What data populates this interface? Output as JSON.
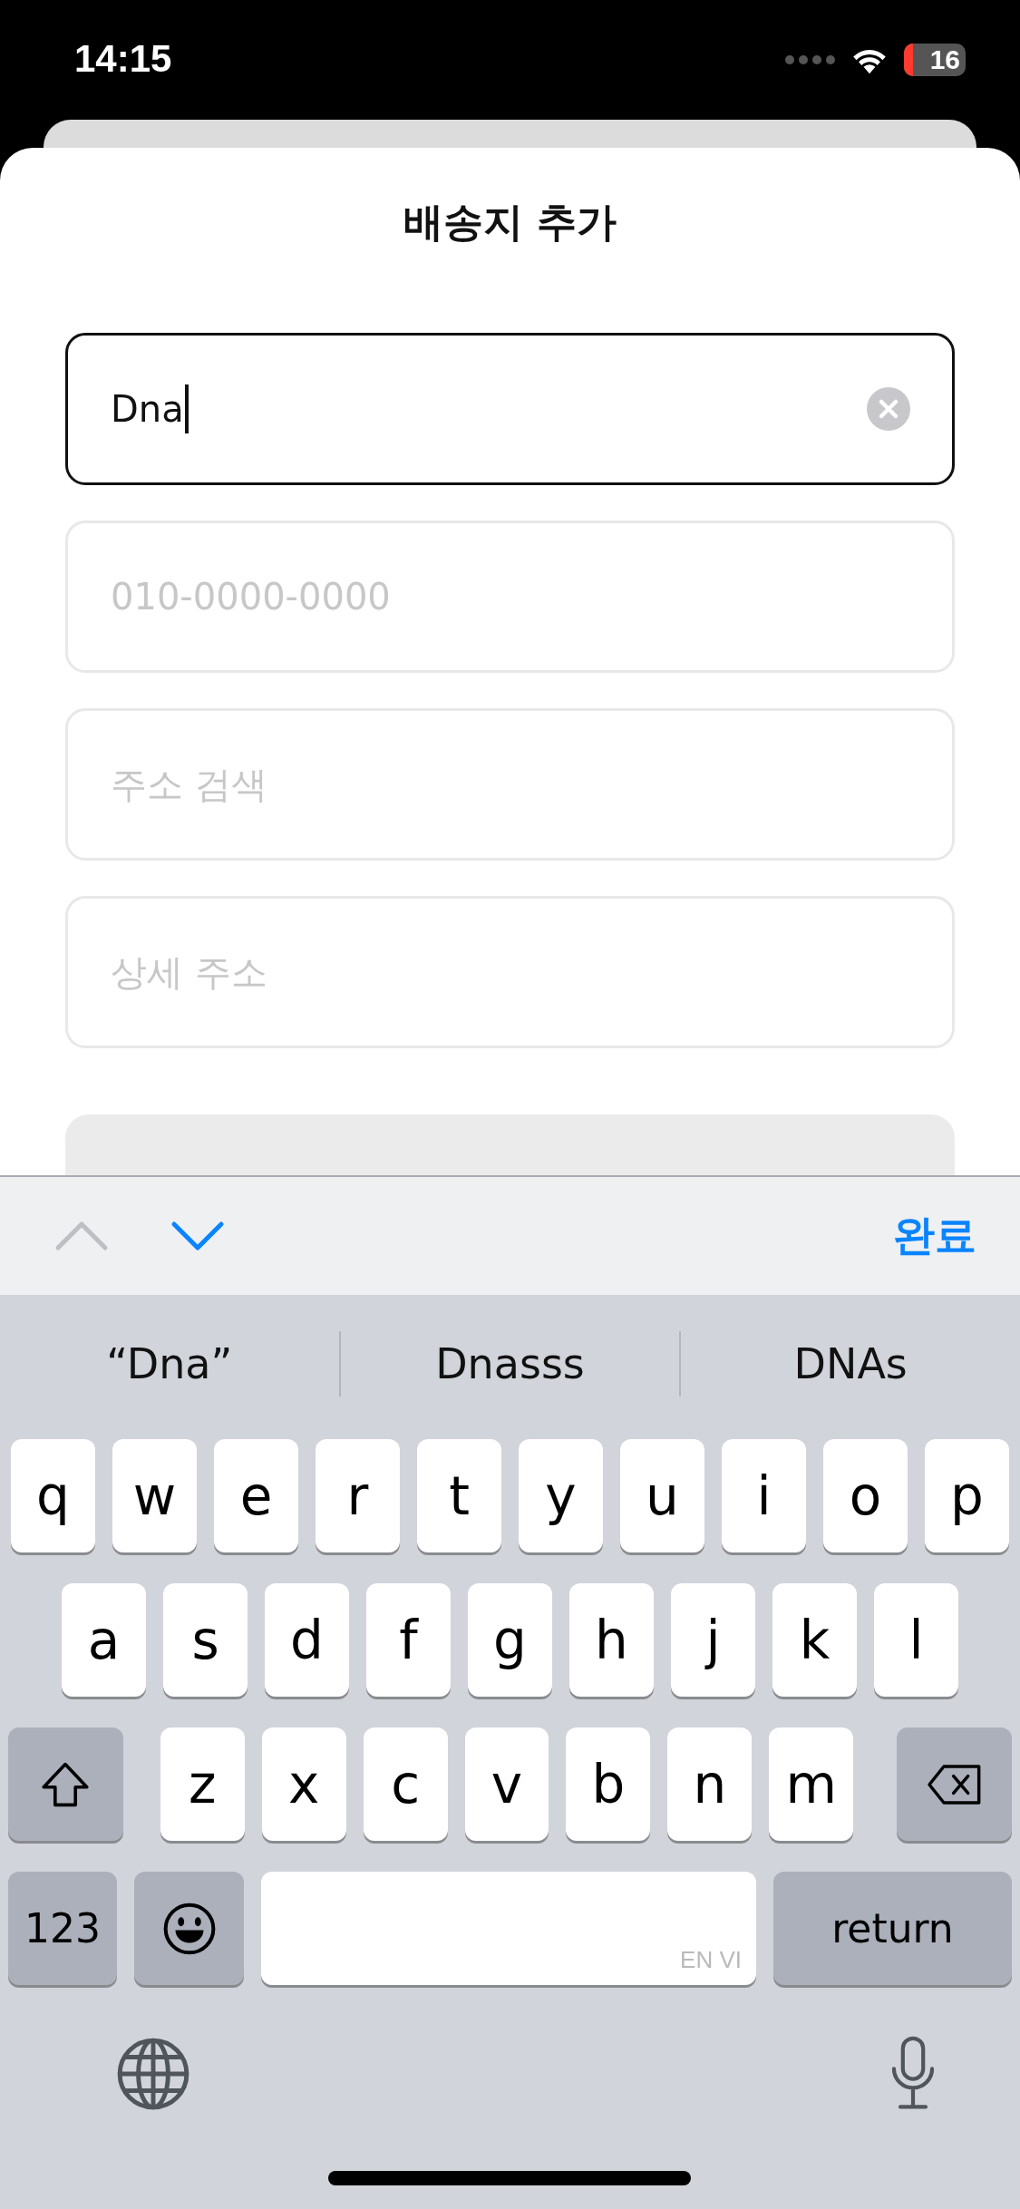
{
  "status_bar": {
    "time": "14:15",
    "battery": "16"
  },
  "sheet": {
    "title": "배송지 추가"
  },
  "fields": [
    {
      "value": "Dna",
      "focused": true
    },
    {
      "placeholder": "010-0000-0000",
      "focused": false
    },
    {
      "placeholder": "주소 검색",
      "focused": false
    },
    {
      "placeholder": "상세 주소",
      "focused": false
    }
  ],
  "toolbar": {
    "previous_enabled": false,
    "next_enabled": true,
    "done": "완료"
  },
  "keyboard": {
    "suggestions": [
      "“Dna”",
      "Dnasss",
      "DNAs"
    ],
    "rows": [
      {
        "keys": [
          {
            "kind": "letter",
            "label": "q"
          },
          {
            "kind": "letter",
            "label": "w"
          },
          {
            "kind": "letter",
            "label": "e"
          },
          {
            "kind": "letter",
            "label": "r"
          },
          {
            "kind": "letter",
            "label": "t"
          },
          {
            "kind": "letter",
            "label": "y"
          },
          {
            "kind": "letter",
            "label": "u"
          },
          {
            "kind": "letter",
            "label": "i"
          },
          {
            "kind": "letter",
            "label": "o"
          },
          {
            "kind": "letter",
            "label": "p"
          }
        ]
      },
      {
        "keys": [
          {
            "kind": "letter",
            "label": "a"
          },
          {
            "kind": "letter",
            "label": "s"
          },
          {
            "kind": "letter",
            "label": "d"
          },
          {
            "kind": "letter",
            "label": "f"
          },
          {
            "kind": "letter",
            "label": "g"
          },
          {
            "kind": "letter",
            "label": "h"
          },
          {
            "kind": "letter",
            "label": "j"
          },
          {
            "kind": "letter",
            "label": "k"
          },
          {
            "kind": "letter",
            "label": "l"
          }
        ]
      },
      {
        "keys": [
          {
            "kind": "shift"
          },
          {
            "kind": "letter",
            "label": "z"
          },
          {
            "kind": "letter",
            "label": "x"
          },
          {
            "kind": "letter",
            "label": "c"
          },
          {
            "kind": "letter",
            "label": "v"
          },
          {
            "kind": "letter",
            "label": "b"
          },
          {
            "kind": "letter",
            "label": "n"
          },
          {
            "kind": "letter",
            "label": "m"
          },
          {
            "kind": "delete"
          }
        ]
      },
      {
        "keys": [
          {
            "kind": "numbers",
            "label": "123"
          },
          {
            "kind": "emoji"
          },
          {
            "kind": "space",
            "languages": "EN VI"
          },
          {
            "kind": "return",
            "label": "return"
          }
        ]
      }
    ]
  }
}
